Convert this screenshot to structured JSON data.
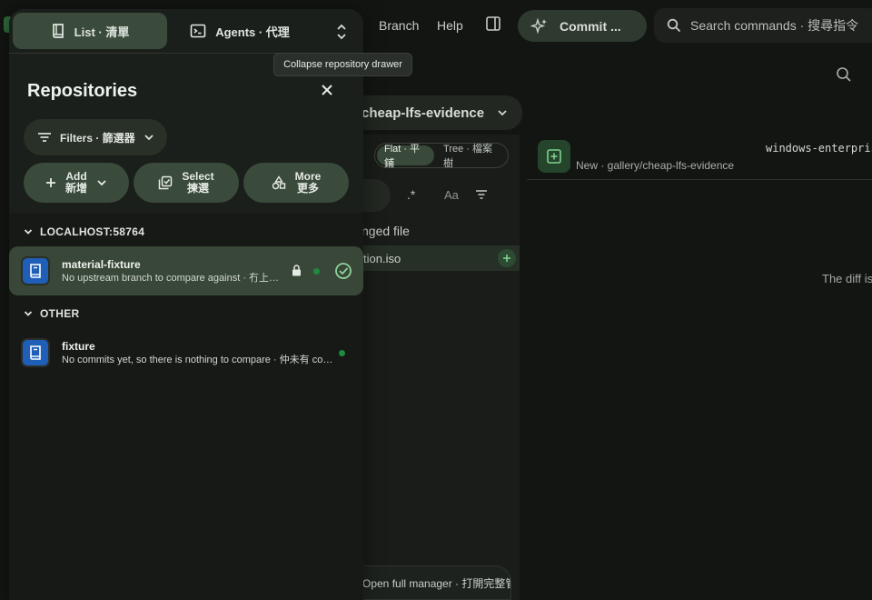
{
  "app": {
    "menu": {
      "branch": "Branch",
      "help": "Help"
    },
    "commit_label": "Commit ...",
    "search_placeholder": "Search commands · 搜尋指令",
    "branch_name": "cheap-lfs-evidence",
    "view_toggle": {
      "flat": "Flat · 平鋪",
      "tree": "Tree · 檔案樹"
    },
    "regex_label": ".*",
    "case_label": "Aa",
    "changed_title": "nged file",
    "file_row": "tion.iso",
    "diff_filename": "windows-enterprise",
    "diff_path": "New · gallery/cheap-lfs-evidence",
    "diff_empty": "The diff is",
    "open_manager": "Open full manager · 打開完整管理"
  },
  "drawer": {
    "tabs": [
      {
        "label": "List · 清單",
        "icon": "book-icon"
      },
      {
        "label": "Agents · 代理",
        "icon": "terminal-icon"
      }
    ],
    "tooltip": "Collapse repository drawer",
    "title": "Repositories",
    "filters_label": "Filters · 篩選器",
    "actions": {
      "add": {
        "line1": "Add",
        "line2": "新增"
      },
      "select": {
        "line1": "Select",
        "line2": "揀選"
      },
      "more": {
        "line1": "More",
        "line2": "更多"
      }
    },
    "sections": [
      {
        "header": "LOCALHOST:58764",
        "repos": [
          {
            "name": "material-fixture",
            "desc": "No upstream branch to compare against · 冇上游分支可以比較",
            "selected": true,
            "locked": true
          }
        ]
      },
      {
        "header": "OTHER",
        "repos": [
          {
            "name": "fixture",
            "desc": "No commits yet, so there is nothing to compare · 仲未有 commit",
            "selected": false,
            "locked": false
          }
        ]
      }
    ]
  },
  "colors": {
    "accent_green": "#1e8a3e",
    "repo_icon_blue": "#1f5fb8",
    "selected_row": "#384738"
  }
}
